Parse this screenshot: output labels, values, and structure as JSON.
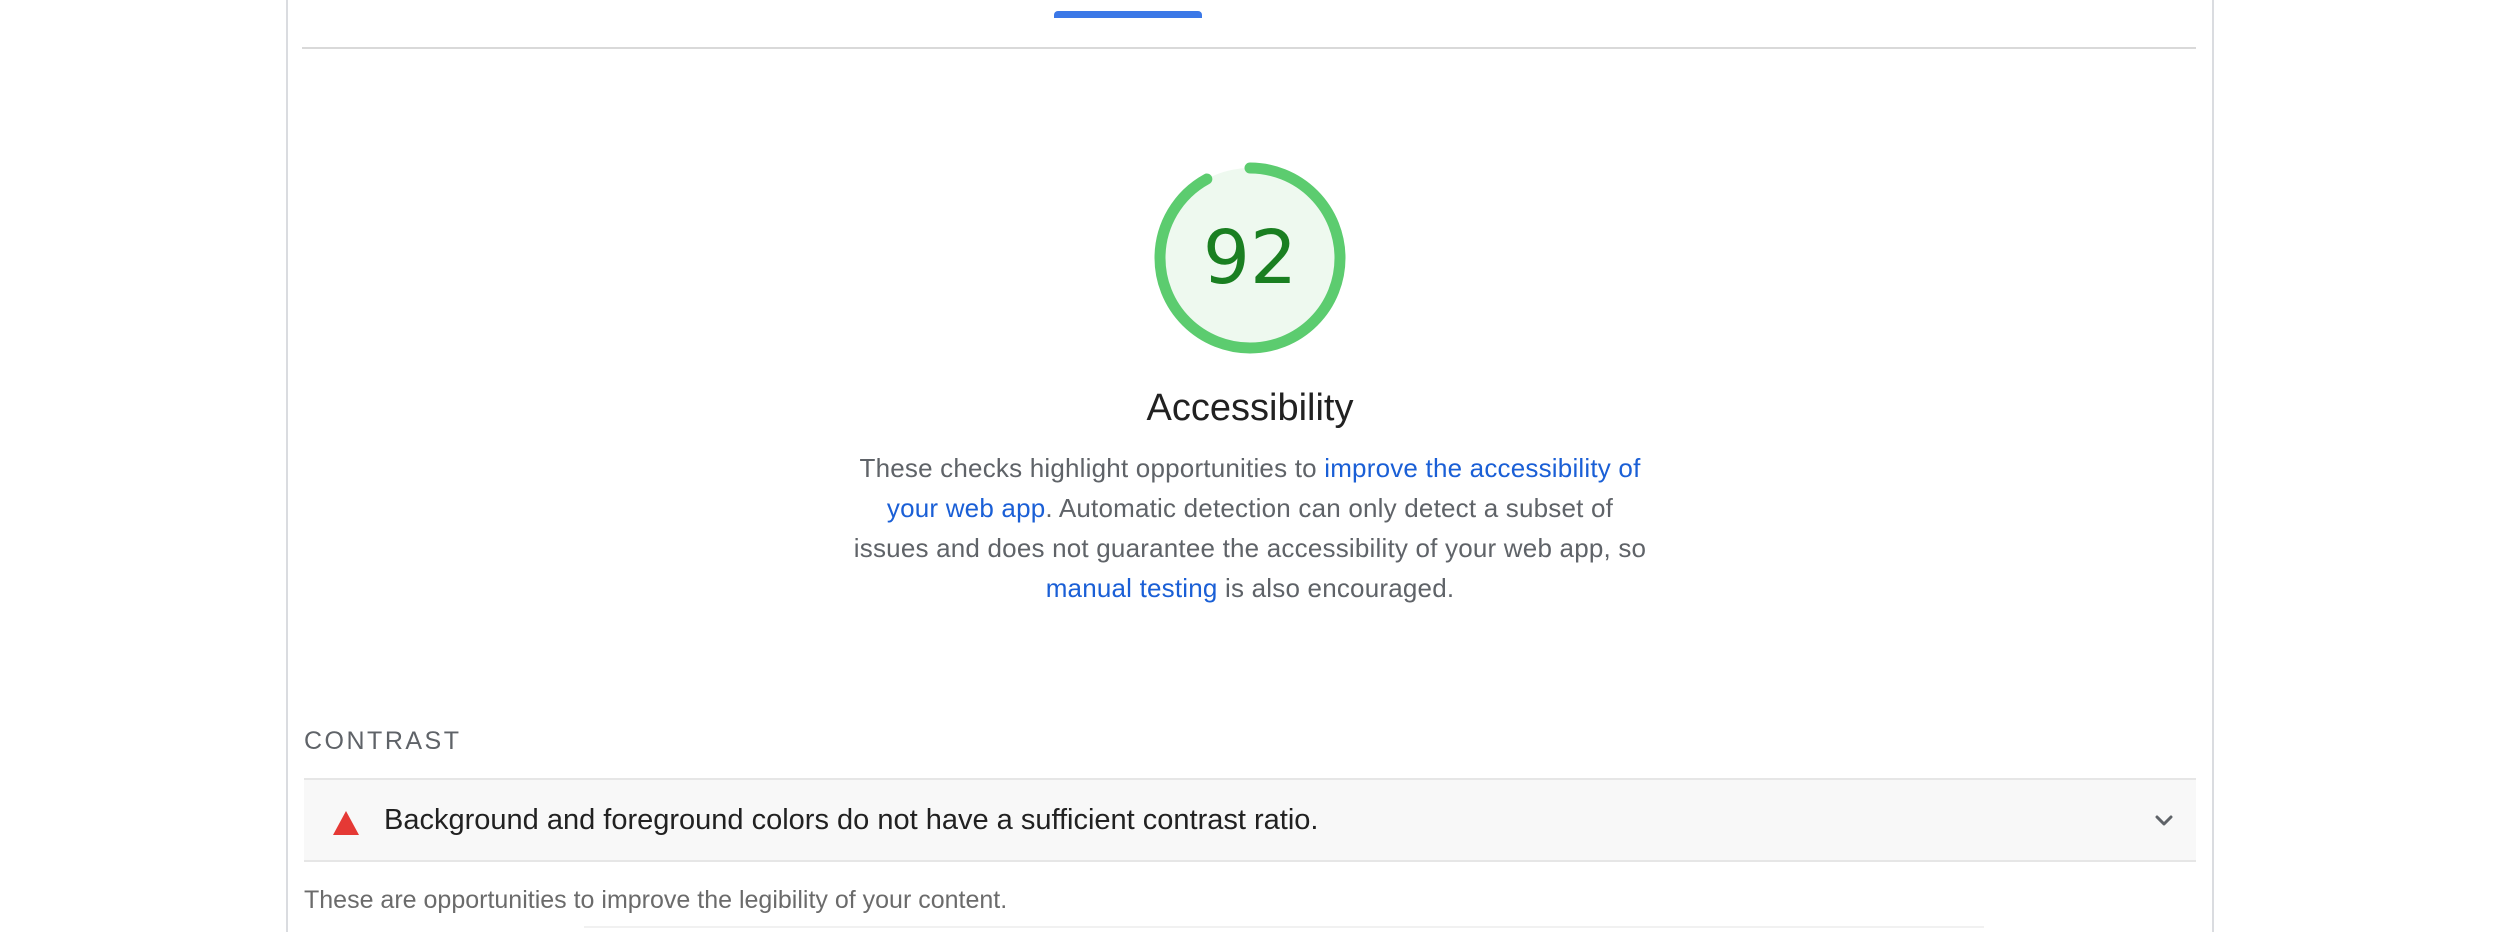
{
  "report": {
    "score": "92",
    "score_fraction": 0.92,
    "category_title": "Accessibility",
    "description": {
      "part1": "These checks highlight opportunities to ",
      "link1": "improve the accessibility of your web app",
      "part2": ". Automatic detection can only detect a subset of issues and does not guarantee the accessibility of your web app, so ",
      "link2": "manual testing",
      "part3": " is also encouraged."
    }
  },
  "group": {
    "title": "CONTRAST",
    "audit_title": "Background and foreground colors do not have a sufficient contrast ratio.",
    "description": "These are opportunities to improve the legibility of your content."
  },
  "icons": {
    "fail": "warning-triangle-icon",
    "expand": "chevron-down-icon"
  },
  "colors": {
    "pass_green": "#0cce6b",
    "score_text": "#1a7f21",
    "link_blue": "#1a5fd6",
    "fail_red": "#e53935",
    "tab_indicator": "#3b78e7"
  }
}
